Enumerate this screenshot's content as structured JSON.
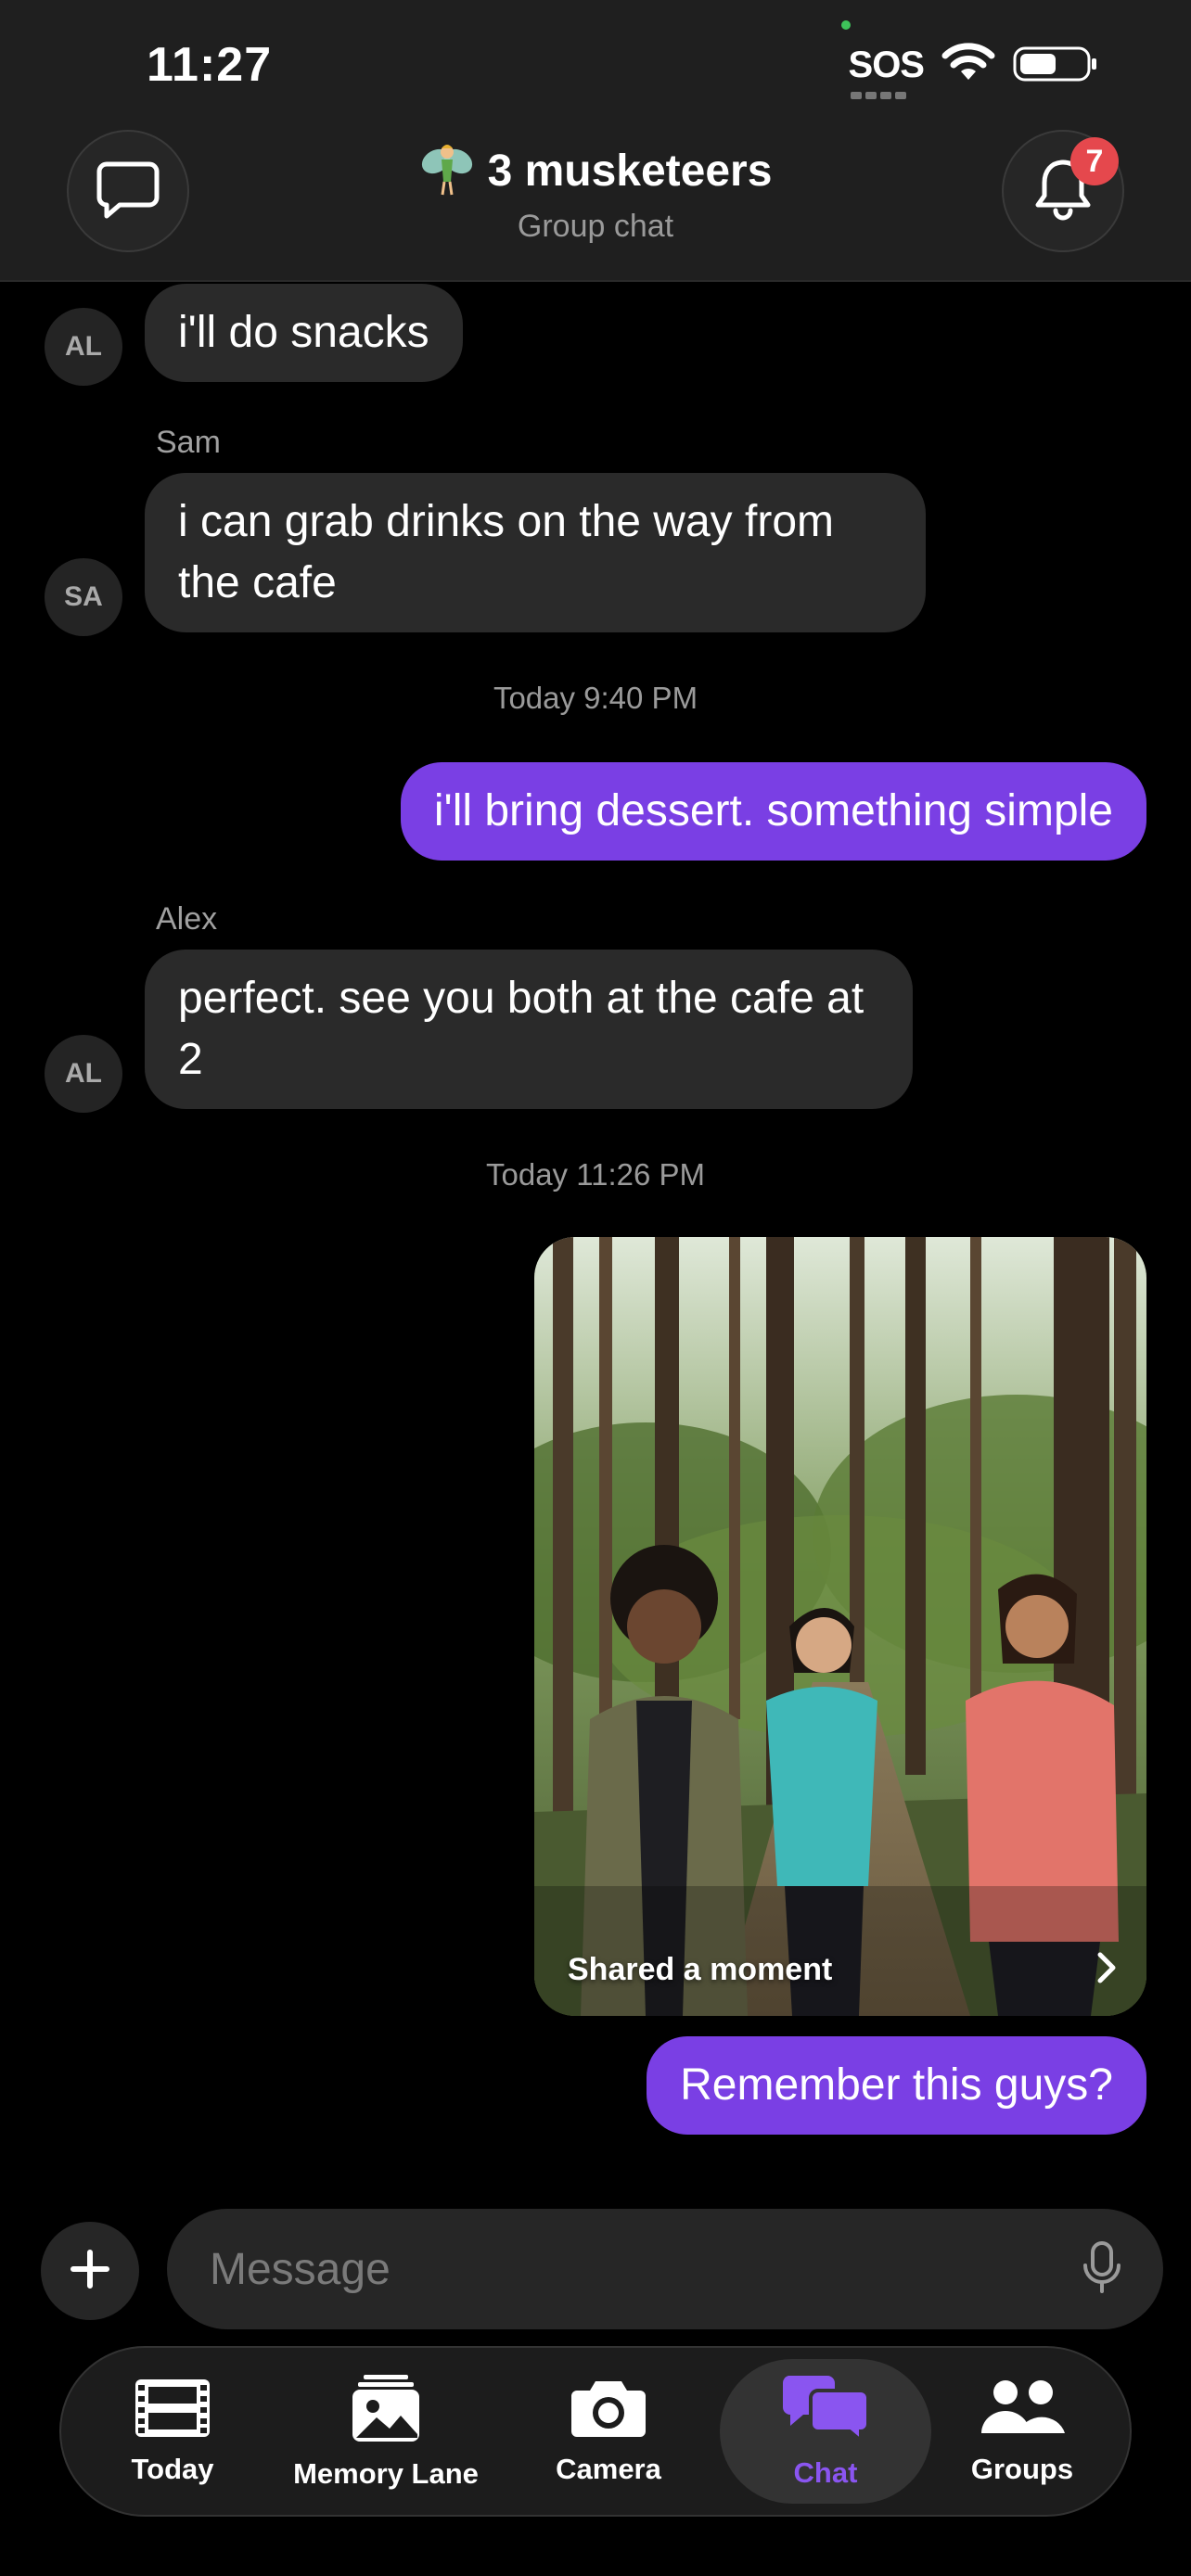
{
  "status_bar": {
    "time": "11:27",
    "sos": "SOS"
  },
  "header": {
    "emoji": "🧚",
    "title": "3 musketeers",
    "subtitle": "Group chat",
    "notification_count": "7"
  },
  "messages": [
    {
      "avatar": "AL",
      "text": "i'll do snacks"
    },
    {
      "sender": "Sam",
      "avatar": "SA",
      "text": "i can grab drinks on the way from the cafe"
    },
    {
      "timestamp": "Today 9:40 PM"
    },
    {
      "outgoing": true,
      "text": "i'll bring dessert. something simple"
    },
    {
      "sender": "Alex",
      "avatar": "AL",
      "text": "perfect. see you both at the cafe at 2"
    },
    {
      "timestamp": "Today 11:26 PM"
    },
    {
      "outgoing": true,
      "photo_caption": "Shared a moment"
    },
    {
      "outgoing": true,
      "text": "Remember this guys?"
    }
  ],
  "composer": {
    "placeholder": "Message"
  },
  "tabs": [
    {
      "label": "Today",
      "icon": "film-icon"
    },
    {
      "label": "Memory Lane",
      "icon": "photos-icon"
    },
    {
      "label": "Camera",
      "icon": "camera-icon"
    },
    {
      "label": "Chat",
      "icon": "chat-bubbles-icon",
      "active": true
    },
    {
      "label": "Groups",
      "icon": "people-icon"
    }
  ],
  "colors": {
    "accent": "#7a3fe4",
    "active_tab": "#8a55f0",
    "badge": "#e5484d",
    "incoming_bubble": "#2a2a2a",
    "background": "#000000"
  }
}
